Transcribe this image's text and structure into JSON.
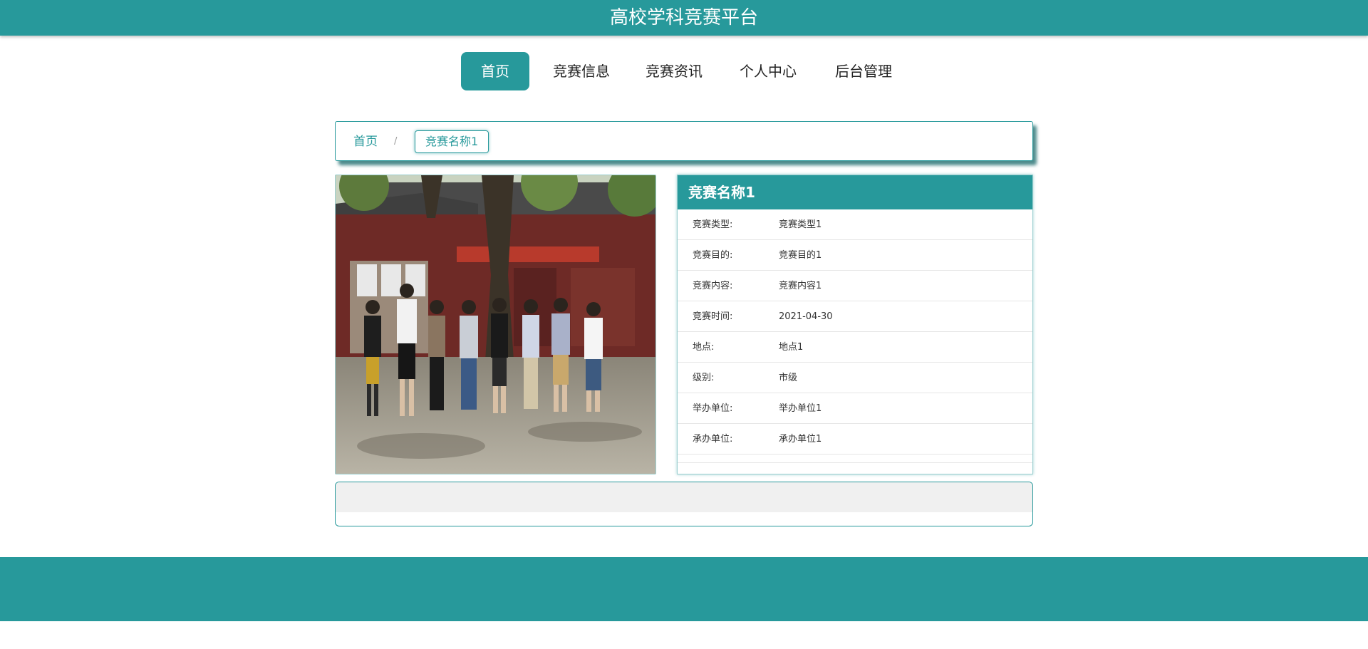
{
  "header": {
    "title": "高校学科竞赛平台"
  },
  "nav": {
    "items": [
      {
        "label": "首页",
        "active": true
      },
      {
        "label": "竞赛信息",
        "active": false
      },
      {
        "label": "竞赛资讯",
        "active": false
      },
      {
        "label": "个人中心",
        "active": false
      },
      {
        "label": "后台管理",
        "active": false
      }
    ]
  },
  "breadcrumb": {
    "home": "首页",
    "separator": "/",
    "current": "竞赛名称1"
  },
  "detail": {
    "name": "竞赛名称1",
    "fields": [
      {
        "label": "竞赛类型:",
        "value": "竞赛类型1"
      },
      {
        "label": "竞赛目的:",
        "value": "竞赛目的1"
      },
      {
        "label": "竞赛内容:",
        "value": "竞赛内容1"
      },
      {
        "label": "竞赛时间:",
        "value": "2021-04-30"
      },
      {
        "label": "地点:",
        "value": "地点1"
      },
      {
        "label": "级别:",
        "value": "市级"
      },
      {
        "label": "举办单位:",
        "value": "举办单位1"
      },
      {
        "label": "承办单位:",
        "value": "承办单位1"
      }
    ]
  },
  "colors": {
    "primary": "#27999b",
    "border": "#9ccfd0",
    "panel": "#f0f0f0"
  }
}
